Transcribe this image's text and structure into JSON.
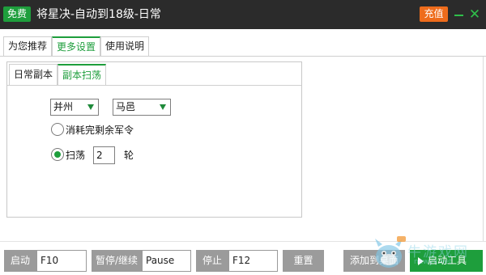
{
  "title_bar": {
    "free_badge": "免费",
    "title": "将星决-自动到18级-日常",
    "recharge": "充值",
    "minimize_icon": "minimize-icon",
    "close_icon": "close-icon"
  },
  "main_tabs": [
    {
      "label": "为您推荐",
      "active": false
    },
    {
      "label": "更多设置",
      "active": true
    },
    {
      "label": "使用说明",
      "active": false
    }
  ],
  "sub_tabs": [
    {
      "label": "日常副本",
      "active": false
    },
    {
      "label": "副本扫荡",
      "active": true
    }
  ],
  "sweep_settings": {
    "region_select": "并州",
    "city_select": "马邑",
    "option_consume": "消耗完剩余军令",
    "option_sweep": "扫荡",
    "sweep_count": "2",
    "sweep_unit": "轮",
    "selected_option": "sweep"
  },
  "bottom_bar": {
    "start_label": "启动",
    "start_hotkey": "F10",
    "pause_label": "暂停/继续",
    "pause_hotkey": "Pause",
    "stop_label": "停止",
    "stop_hotkey": "F12",
    "reset_label": "重置",
    "add_label": "添加到桌面",
    "launch_tool_label": "启动工具"
  },
  "watermark": {
    "text": "牛游戏网",
    "url": "newyx.net"
  },
  "colors": {
    "accent_green": "#1e9e3c",
    "titlebar_bg": "#2b2b2b",
    "recharge_orange": "#ee6c1c",
    "button_gray": "#9b9b9b"
  }
}
